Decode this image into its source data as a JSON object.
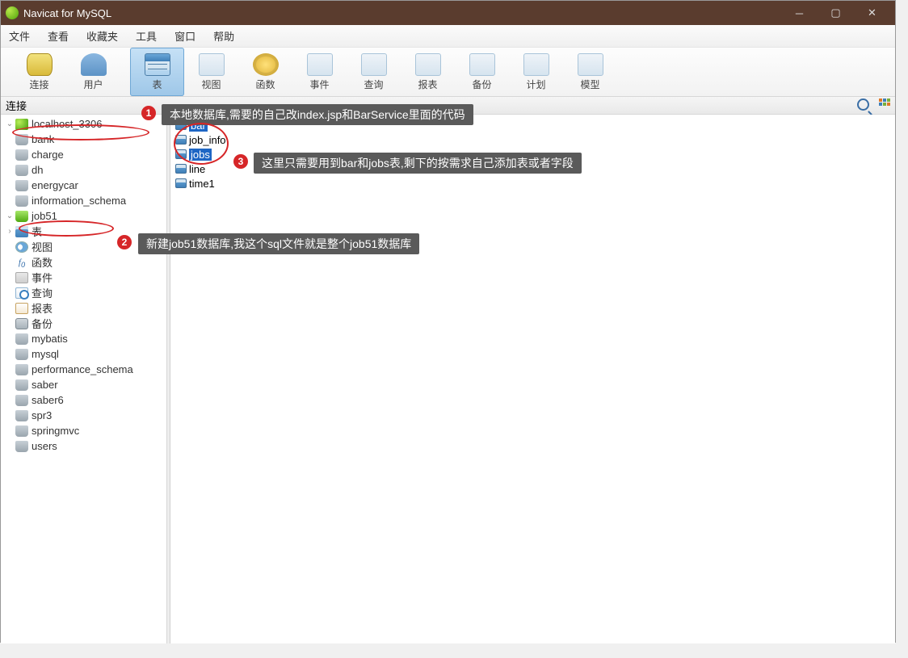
{
  "titlebar": {
    "title": "Navicat for MySQL"
  },
  "menu": {
    "file": "文件",
    "view": "查看",
    "fav": "收藏夹",
    "tool": "工具",
    "window": "窗口",
    "help": "帮助"
  },
  "toolbar": {
    "connect": "连接",
    "user": "用户",
    "table": "表",
    "view": "视图",
    "func": "函数",
    "event": "事件",
    "query": "查询",
    "report": "报表",
    "backup": "备份",
    "schedule": "计划",
    "model": "模型"
  },
  "subheader": {
    "label": "连接"
  },
  "connection": {
    "name": "localhost_3306"
  },
  "dbs_before": [
    "bank",
    "charge",
    "dh",
    "energycar",
    "information_schema"
  ],
  "job51": {
    "name": "job51",
    "children": {
      "table": "表",
      "view": "视图",
      "func": "函数",
      "event": "事件",
      "query": "查询",
      "report": "报表",
      "backup": "备份"
    }
  },
  "dbs_after": [
    "mybatis",
    "mysql",
    "performance_schema",
    "saber",
    "saber6",
    "spr3",
    "springmvc",
    "users"
  ],
  "tables": [
    "bar",
    "job_info",
    "jobs",
    "line",
    "time1"
  ],
  "annotations": {
    "a1": "本地数据库,需要的自己改index.jsp和BarService里面的代码",
    "a2": "新建job51数据库,我这个sql文件就是整个job51数据库",
    "a3": "这里只需要用到bar和jobs表,剩下的按需求自己添加表或者字段"
  }
}
